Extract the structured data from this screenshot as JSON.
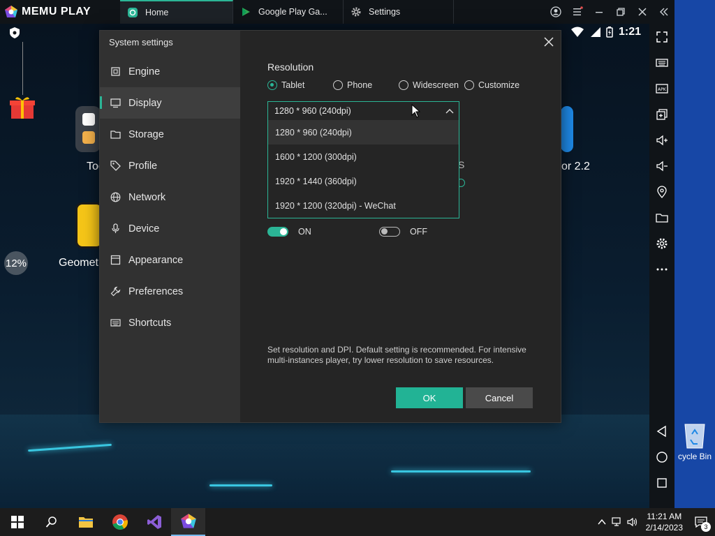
{
  "titlebar": {
    "brand": "MEMU PLAY",
    "tabs": [
      {
        "label": "Home",
        "active": true
      },
      {
        "label": "Google Play Ga...",
        "active": false
      },
      {
        "label": "Settings",
        "active": false
      }
    ]
  },
  "android": {
    "status_time": "1:21",
    "progress_badge": "12%",
    "apps": [
      {
        "label": "Too"
      },
      {
        "label": "Geomet"
      },
      {
        "label": "or 2.2"
      }
    ]
  },
  "dialog": {
    "title": "System settings",
    "nav": [
      {
        "label": "Engine",
        "icon": "chip-icon"
      },
      {
        "label": "Display",
        "icon": "monitor-icon",
        "active": true
      },
      {
        "label": "Storage",
        "icon": "folder-icon"
      },
      {
        "label": "Profile",
        "icon": "tag-icon"
      },
      {
        "label": "Network",
        "icon": "globe-icon"
      },
      {
        "label": "Device",
        "icon": "microphone-icon"
      },
      {
        "label": "Appearance",
        "icon": "appearance-icon"
      },
      {
        "label": "Preferences",
        "icon": "wrench-icon"
      },
      {
        "label": "Shortcuts",
        "icon": "keyboard-icon"
      }
    ],
    "resolution": {
      "label": "Resolution",
      "options": [
        {
          "label": "Tablet",
          "selected": true
        },
        {
          "label": "Phone",
          "selected": false
        },
        {
          "label": "Widescreen",
          "selected": false
        },
        {
          "label": "Customize",
          "selected": false
        }
      ],
      "current": "1280 * 960 (240dpi)",
      "dropdown": [
        "1280 * 960 (240dpi)",
        "1600 * 1200 (300dpi)",
        "1920 * 1440 (360dpi)",
        "1920 * 1200 (320dpi) - WeChat"
      ]
    },
    "obscured_text": "S",
    "toggles": [
      {
        "label": "ON",
        "state": true
      },
      {
        "label": "OFF",
        "state": false
      }
    ],
    "hint": "Set resolution and DPI. Default setting is recommended. For intensive multi-instances player, try lower resolution to save resources.",
    "ok_label": "OK",
    "cancel_label": "Cancel"
  },
  "desktop": {
    "recycle_label": "cycle Bin"
  },
  "taskbar": {
    "time": "11:21 AM",
    "date": "2/14/2023",
    "notifications": "3"
  },
  "colors": {
    "accent": "#2bb596",
    "dialog_bg": "#252525",
    "nav_bg": "#313131",
    "desktop_blue": "#1747a6"
  }
}
